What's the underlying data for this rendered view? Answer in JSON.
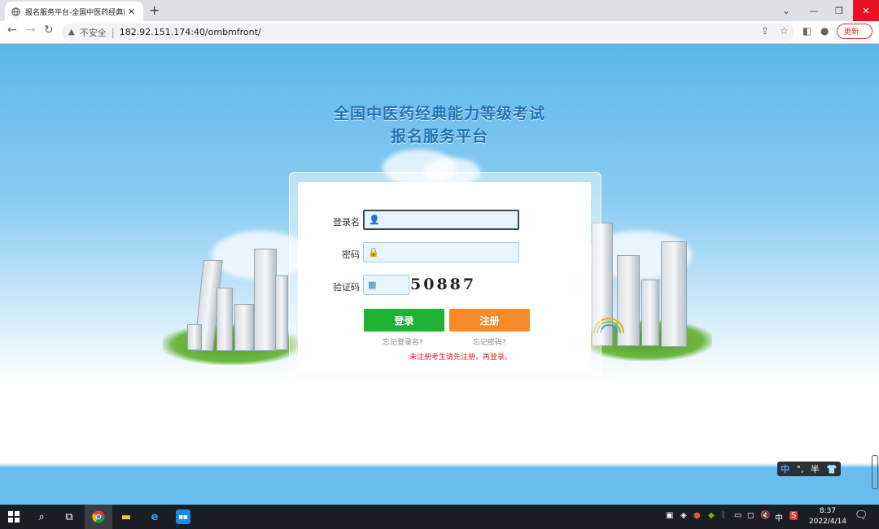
{
  "browser": {
    "tab_title": "报名服务平台-全国中医药经典能",
    "tab_close": "✕",
    "new_tab": "+",
    "insecure_label": "不安全",
    "url": "182.92.151.174:40/ombmfront/",
    "update_label": "更新",
    "close_tooltip": "关闭"
  },
  "page": {
    "title_line1": "全国中医药经典能力等级考试",
    "title_line2": "报名服务平台"
  },
  "login": {
    "username_label": "登录名",
    "password_label": "密码",
    "captcha_label": "验证码",
    "username_value": "",
    "password_value": "",
    "captcha_value": "",
    "captcha_text": "50887",
    "login_button": "登录",
    "register_button": "注册",
    "forgot_username": "忘记登录名?",
    "forgot_password": "忘记密码?",
    "notice": "未注册考生请先注册，再登录。"
  },
  "ime": {
    "mode": "中",
    "punct": "°,",
    "width": "半",
    "skin": "👕"
  },
  "taskbar": {
    "time": "8:37",
    "date": "2022/4/14",
    "input_method": "中"
  },
  "colors": {
    "login_green": "#1fb233",
    "register_orange": "#f58a2a",
    "title_blue": "#1f73b7",
    "notice_red": "#e02020"
  }
}
